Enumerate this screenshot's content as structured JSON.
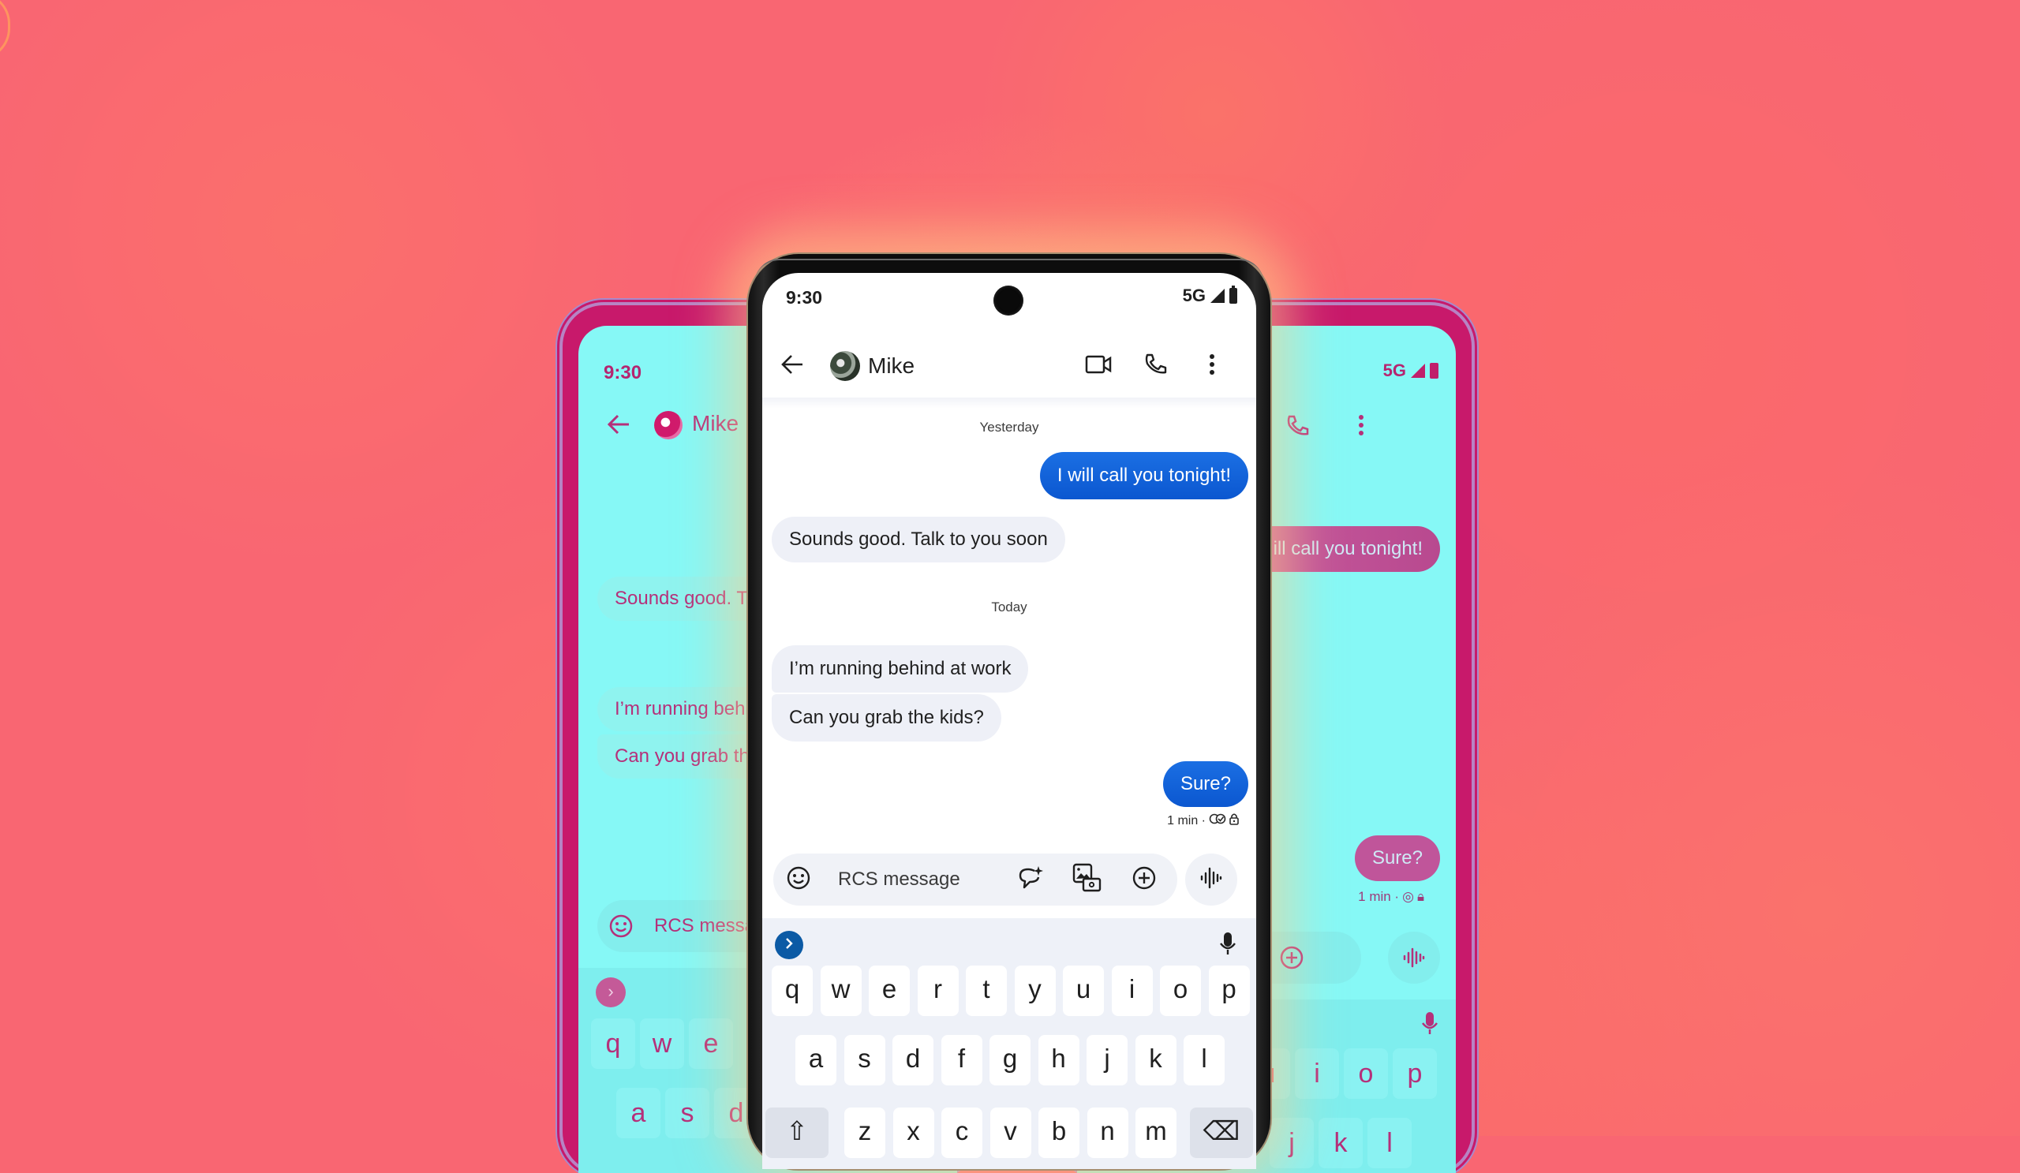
{
  "colors": {
    "background_pink": "#f96672",
    "background_orange_glow": "#fda46d",
    "outgoing_bubble": "#0b57d0",
    "incoming_bubble": "#eef0f7",
    "tint_cyan": "#86f8f6",
    "tint_magenta": "#c8196b"
  },
  "status_bar": {
    "time": "9:30",
    "network": "5G"
  },
  "conversation": {
    "contact_name": "Mike",
    "date_separators": [
      "Yesterday",
      "Today"
    ],
    "messages": [
      {
        "direction": "outgoing",
        "text": "I will call you tonight!"
      },
      {
        "direction": "incoming",
        "text": "Sounds good. Talk to you soon"
      },
      {
        "direction": "incoming",
        "text": "I’m running behind at work"
      },
      {
        "direction": "incoming",
        "text": "Can you grab the kids?"
      },
      {
        "direction": "outgoing",
        "text": "Sure?"
      }
    ],
    "last_meta": "1 min ·"
  },
  "compose": {
    "placeholder": "RCS message"
  },
  "keyboard": {
    "row1": [
      "q",
      "w",
      "e",
      "r",
      "t",
      "y",
      "u",
      "i",
      "o",
      "p"
    ],
    "row2": [
      "a",
      "s",
      "d",
      "f",
      "g",
      "h",
      "j",
      "k",
      "l"
    ],
    "row3": [
      "z",
      "x",
      "c",
      "v",
      "b",
      "n",
      "m"
    ]
  },
  "left_phone": {
    "time": "9:30",
    "contact_name": "Mike",
    "visible_messages": [
      "Sounds good. Ta",
      "I’m running behi",
      "Can you grab th"
    ],
    "compose_placeholder": "RCS messa",
    "row1": [
      "q",
      "w",
      "e"
    ],
    "row2": [
      "a",
      "s",
      "d"
    ]
  },
  "right_phone": {
    "network": "5G",
    "visible_messages": [
      "ill call you tonight!",
      "Sure?"
    ],
    "meta": "1 min ·",
    "row1": [
      "u",
      "i",
      "o",
      "p"
    ],
    "row2": [
      "j",
      "k",
      "l"
    ]
  },
  "icons": {
    "back": "arrow-left",
    "video_call": "video-camera",
    "voice_call": "phone",
    "more": "more-vertical",
    "emoji": "smiley",
    "magic_compose": "chat-sparkle",
    "gallery": "image-camera",
    "attach": "plus-circle",
    "voice_message": "waveform",
    "expand": "chevron-right",
    "mic": "microphone",
    "read_receipt": "double-check",
    "encrypted": "lock"
  }
}
